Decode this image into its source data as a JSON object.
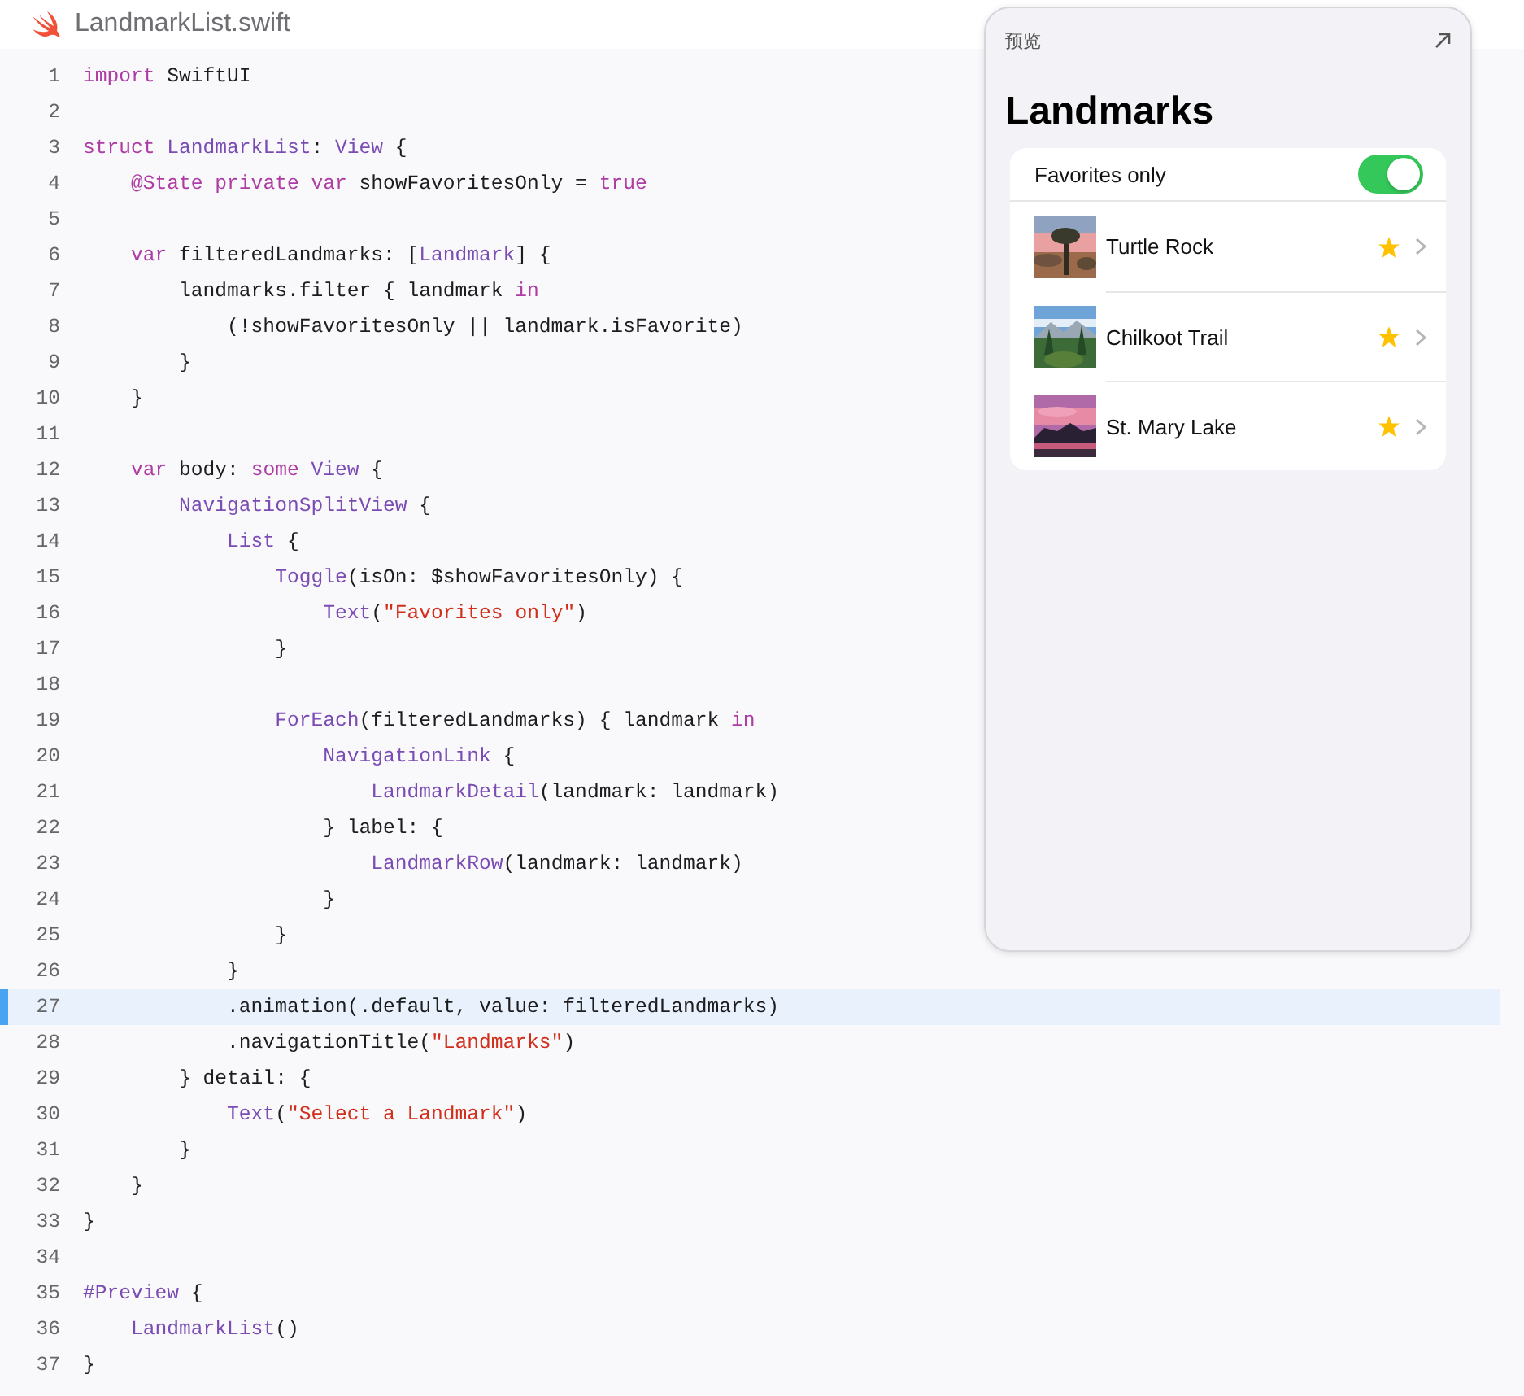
{
  "file_tab": {
    "title": "LandmarkList.swift"
  },
  "code_lines": [
    {
      "number": "1",
      "selected": false,
      "tokens": [
        {
          "kind": "keyword",
          "text": "import"
        },
        {
          "kind": "plain",
          "text": " SwiftUI"
        }
      ]
    },
    {
      "number": "2",
      "selected": false
    },
    {
      "number": "3",
      "selected": false,
      "tokens": [
        {
          "kind": "keyword",
          "text": "struct "
        },
        {
          "kind": "type",
          "text": "LandmarkList"
        },
        {
          "kind": "plain",
          "text": ": "
        },
        {
          "kind": "type",
          "text": "View"
        },
        {
          "kind": "plain",
          "text": " {"
        }
      ]
    },
    {
      "number": "4",
      "selected": false,
      "tokens": [
        {
          "kind": "keyword",
          "text": "@State private var"
        },
        {
          "kind": "plain",
          "text": " showFavoritesOnly = "
        },
        {
          "kind": "keyword",
          "text": "true"
        }
      ]
    },
    {
      "number": "5",
      "selected": false
    },
    {
      "number": "6",
      "selected": false,
      "tokens": [
        {
          "kind": "keyword",
          "text": "var"
        },
        {
          "kind": "plain",
          "text": " filteredLandmarks: ["
        },
        {
          "kind": "type",
          "text": "Landmark"
        },
        {
          "kind": "plain",
          "text": "] {"
        }
      ]
    },
    {
      "number": "7",
      "selected": false,
      "tokens": [
        {
          "kind": "plain",
          "text": "landmarks.filter { landmark "
        },
        {
          "kind": "keyword",
          "text": "in"
        }
      ]
    },
    {
      "number": "8",
      "selected": false,
      "tokens": [
        {
          "kind": "plain",
          "text": "(!showFavoritesOnly || landmark.isFavorite)"
        }
      ]
    },
    {
      "number": "9",
      "selected": false,
      "tokens": [
        {
          "kind": "plain",
          "text": "}"
        }
      ]
    },
    {
      "number": "10",
      "selected": false,
      "tokens": [
        {
          "kind": "plain",
          "text": "}"
        }
      ]
    },
    {
      "number": "11",
      "selected": false
    },
    {
      "number": "12",
      "selected": false,
      "tokens": [
        {
          "kind": "keyword",
          "text": "var"
        },
        {
          "kind": "plain",
          "text": " body: "
        },
        {
          "kind": "keyword",
          "text": "some "
        },
        {
          "kind": "type",
          "text": "View"
        },
        {
          "kind": "plain",
          "text": " {"
        }
      ]
    },
    {
      "number": "13",
      "selected": false,
      "tokens": [
        {
          "kind": "type",
          "text": "NavigationSplitView"
        },
        {
          "kind": "plain",
          "text": " {"
        }
      ]
    },
    {
      "number": "14",
      "selected": false,
      "tokens": [
        {
          "kind": "type",
          "text": "List"
        },
        {
          "kind": "plain",
          "text": " {"
        }
      ]
    },
    {
      "number": "15",
      "selected": false,
      "tokens": [
        {
          "kind": "type",
          "text": "Toggle"
        },
        {
          "kind": "plain",
          "text": "(isOn: $showFavoritesOnly) {"
        }
      ]
    },
    {
      "number": "16",
      "selected": false,
      "tokens": [
        {
          "kind": "type",
          "text": "Text"
        },
        {
          "kind": "plain",
          "text": "("
        },
        {
          "kind": "string",
          "text": "\"Favorites only\""
        },
        {
          "kind": "plain",
          "text": ")"
        }
      ]
    },
    {
      "number": "17",
      "selected": false,
      "tokens": [
        {
          "kind": "plain",
          "text": "}"
        }
      ]
    },
    {
      "number": "18",
      "selected": false
    },
    {
      "number": "19",
      "selected": false,
      "tokens": [
        {
          "kind": "type",
          "text": "ForEach"
        },
        {
          "kind": "plain",
          "text": "(filteredLandmarks) { landmark "
        },
        {
          "kind": "keyword",
          "text": "in"
        }
      ]
    },
    {
      "number": "20",
      "selected": false,
      "tokens": [
        {
          "kind": "type",
          "text": "NavigationLink"
        },
        {
          "kind": "plain",
          "text": " {"
        }
      ]
    },
    {
      "number": "21",
      "selected": false,
      "tokens": [
        {
          "kind": "type",
          "text": "LandmarkDetail"
        },
        {
          "kind": "plain",
          "text": "(landmark: landmark)"
        }
      ]
    },
    {
      "number": "22",
      "selected": false,
      "tokens": [
        {
          "kind": "plain",
          "text": "} label: {"
        }
      ]
    },
    {
      "number": "23",
      "selected": false,
      "tokens": [
        {
          "kind": "type",
          "text": "LandmarkRow"
        },
        {
          "kind": "plain",
          "text": "(landmark: landmark)"
        }
      ]
    },
    {
      "number": "24",
      "selected": false,
      "tokens": [
        {
          "kind": "plain",
          "text": "}"
        }
      ]
    },
    {
      "number": "25",
      "selected": false,
      "tokens": [
        {
          "kind": "plain",
          "text": "}"
        }
      ]
    },
    {
      "number": "26",
      "selected": false,
      "tokens": [
        {
          "kind": "plain",
          "text": "}"
        }
      ]
    },
    {
      "number": "27",
      "selected": true,
      "tokens": [
        {
          "kind": "plain",
          "text": ".animation(.default, value: filteredLandmarks)"
        }
      ]
    },
    {
      "number": "28",
      "selected": false,
      "tokens": [
        {
          "kind": "plain",
          "text": ".navigationTitle("
        },
        {
          "kind": "string",
          "text": "\"Landmarks\""
        },
        {
          "kind": "plain",
          "text": ")"
        }
      ]
    },
    {
      "number": "29",
      "selected": false,
      "tokens": [
        {
          "kind": "plain",
          "text": "} detail: {"
        }
      ]
    },
    {
      "number": "30",
      "selected": false,
      "tokens": [
        {
          "kind": "type",
          "text": "Text"
        },
        {
          "kind": "plain",
          "text": "("
        },
        {
          "kind": "string",
          "text": "\"Select a Landmark\""
        },
        {
          "kind": "plain",
          "text": ")"
        }
      ]
    },
    {
      "number": "31",
      "selected": false,
      "tokens": [
        {
          "kind": "plain",
          "text": "}"
        }
      ]
    },
    {
      "number": "32",
      "selected": false,
      "tokens": [
        {
          "kind": "plain",
          "text": "}"
        }
      ]
    },
    {
      "number": "33",
      "selected": false,
      "tokens": [
        {
          "kind": "plain",
          "text": "}"
        }
      ]
    },
    {
      "number": "34",
      "selected": false
    },
    {
      "number": "35",
      "selected": false,
      "tokens": [
        {
          "kind": "type",
          "text": "#Preview"
        },
        {
          "kind": "plain",
          "text": " {"
        }
      ]
    },
    {
      "number": "36",
      "selected": false,
      "tokens": [
        {
          "kind": "type",
          "text": "LandmarkList"
        },
        {
          "kind": "plain",
          "text": "()"
        }
      ]
    },
    {
      "number": "37",
      "selected": false,
      "tokens": [
        {
          "kind": "plain",
          "text": "}"
        }
      ]
    }
  ],
  "preview": {
    "title": "预览",
    "nav_title": "Landmarks",
    "toggle": {
      "label": "Favorites only",
      "on": true
    },
    "rows": [
      {
        "name": "Turtle Rock",
        "favorite": true
      },
      {
        "name": "Chilkoot Trail",
        "favorite": true
      },
      {
        "name": "St. Mary Lake",
        "favorite": true
      }
    ]
  }
}
